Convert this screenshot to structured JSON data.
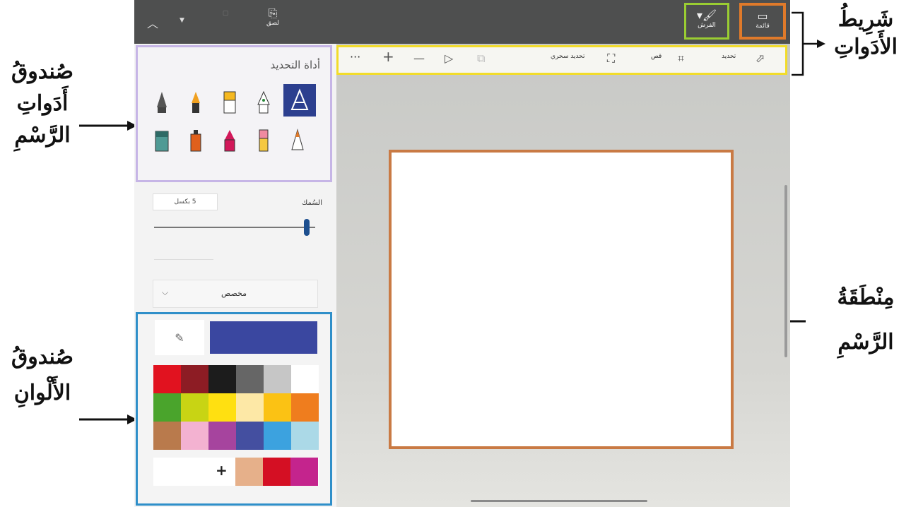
{
  "callouts": {
    "toolbar_line1": "شَرِيطُ",
    "toolbar_line2": "الأَدَواتِ",
    "drawtools_line1": "صُندوقُ",
    "drawtools_line2": "أَدَواتِ",
    "drawtools_line3": "الرَّسْمِ",
    "drawarea_line1": "مِنْطَقَةُ",
    "drawarea_line2": "الرَّسْمِ",
    "colors_line1": "صُندوقُ",
    "colors_line2": "الأَلْوانِ"
  },
  "topbar": {
    "menu_label": "قائمة",
    "brushes_label": "الفرش",
    "left_label": "لصق"
  },
  "toolbar": {
    "select_label": "تحديد",
    "crop_label": "قص",
    "magic_select_label": "تحديد سحري",
    "more": "···",
    "plus": "+",
    "minus": "—"
  },
  "drawtools": {
    "title": "أداة التحديد"
  },
  "thickness": {
    "label": "السُمك",
    "value": "5 بكسل"
  },
  "brush_mode": {
    "value": "مخصص"
  },
  "colors": {
    "current": "#3a47a0",
    "palette": [
      [
        "#e1121f",
        "#8d1c24",
        "#1c1c1c",
        "#666666",
        "#c6c6c6",
        "#ffffff"
      ],
      [
        "#4aa42c",
        "#c8d414",
        "#ffe011",
        "#fde8a6",
        "#fbc214",
        "#ef7d1e"
      ],
      [
        "#b97a4c",
        "#f3b2d1",
        "#a6449e",
        "#444fa0",
        "#3ca2df",
        "#abd9e7"
      ]
    ],
    "custom": [
      "#e6b08a",
      "#d40f23",
      "#c4248d"
    ],
    "add_label": "+"
  },
  "icons": {
    "crop": "crop-icon",
    "select": "select-cursor-icon",
    "magic": "magic-select-icon",
    "eyedropper": "eyedropper-icon"
  }
}
